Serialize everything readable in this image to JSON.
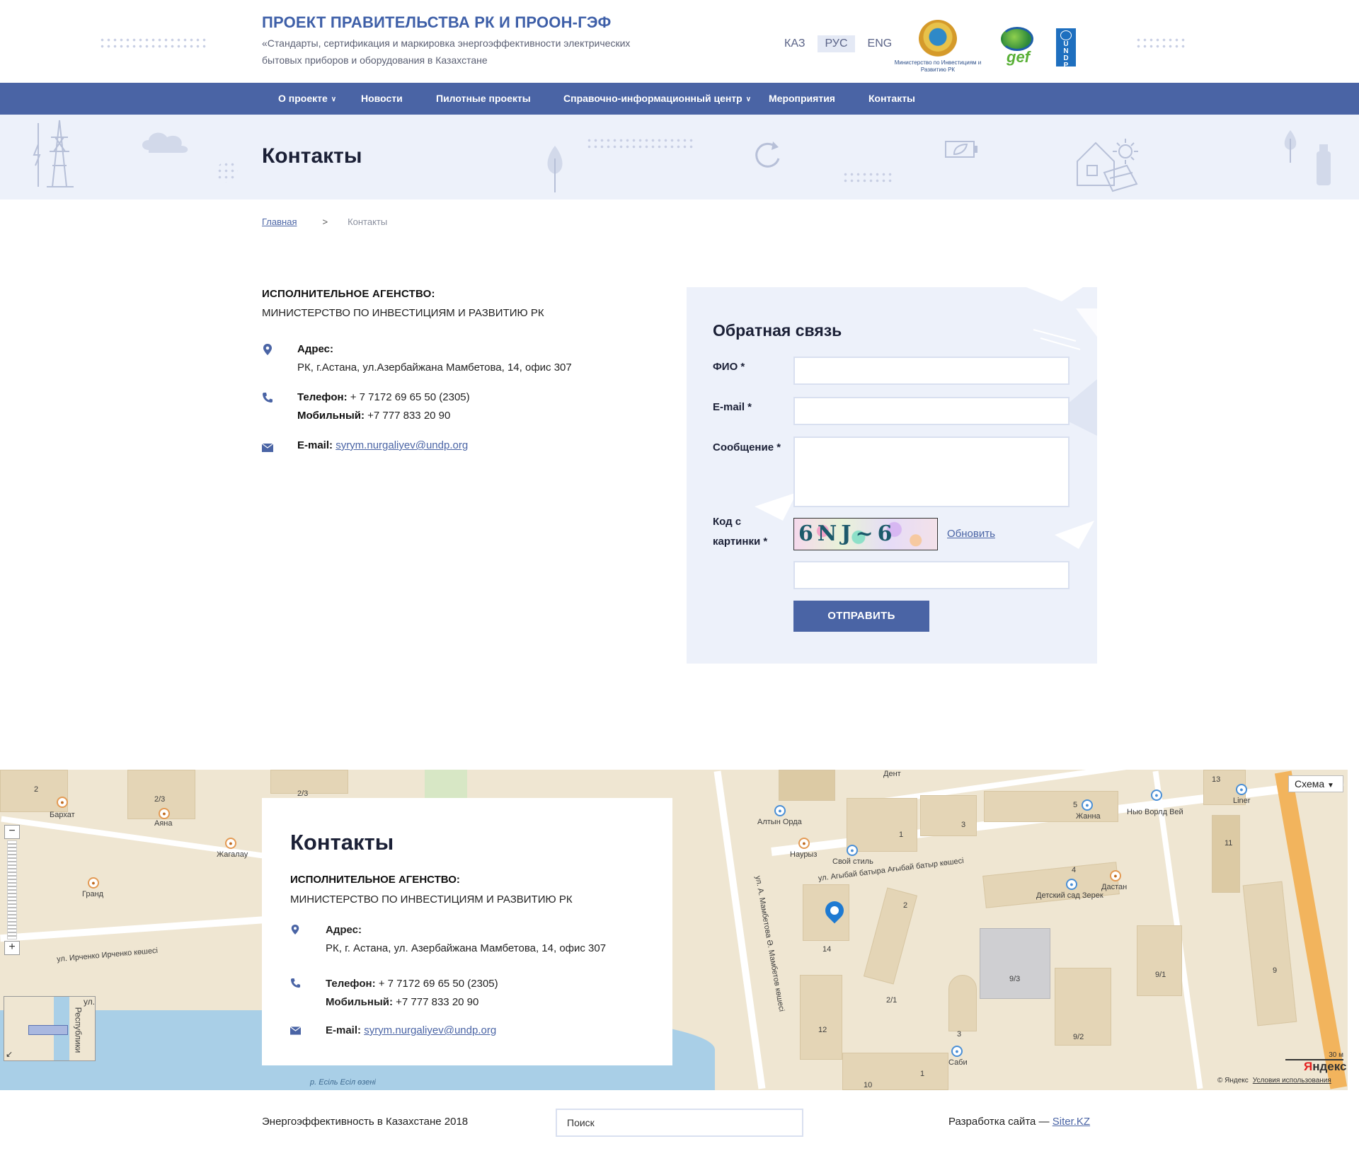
{
  "header": {
    "title": "ПРОЕКТ ПРАВИТЕЛЬСТВА РК И ПРООН-ГЭФ",
    "subtitle": "«Стандарты, сертификация и маркировка энергоэффективности электрических бытовых приборов и оборудования в Казахстане",
    "languages": [
      "КАЗ",
      "РУС",
      "ENG"
    ],
    "active_language": "РУС",
    "ministry_caption": "Министерство по Инвестициям и Развитию РК",
    "gef_label": "gef",
    "undp_label": "U N D P"
  },
  "nav": {
    "items": [
      {
        "label": "О проекте",
        "has_dropdown": true
      },
      {
        "label": "Новости",
        "has_dropdown": false
      },
      {
        "label": "Пилотные проекты",
        "has_dropdown": false
      },
      {
        "label": "Справочно-информационный центр",
        "has_dropdown": true
      },
      {
        "label": "Мероприятия",
        "has_dropdown": false
      },
      {
        "label": "Контакты",
        "has_dropdown": false
      }
    ]
  },
  "banner": {
    "title": "Контакты"
  },
  "breadcrumb": {
    "home": "Главная",
    "separator": ">",
    "current": "Контакты"
  },
  "contacts": {
    "agency_label": "ИСПОЛНИТЕЛЬНОЕ АГЕНСТВО:",
    "agency": "МИНИСТЕРСТВО ПО ИНВЕСТИЦИЯМ И РАЗВИТИЮ РК",
    "address_label": "Адрес:",
    "address": "РК, г.Астана, ул.Азербайжана Мамбетова, 14, офис 307",
    "phone_label": "Телефон:",
    "phone": "+ 7 7172 69 65 50 (2305)",
    "mobile_label": "Мобильный:",
    "mobile": "+7 777 833 20 90",
    "email_label": "E-mail:",
    "email": "syrym.nurgaliyev@undp.org"
  },
  "form": {
    "title": "Обратная связь",
    "name_label": "ФИО *",
    "email_label": "E-mail *",
    "message_label": "Сообщение *",
    "captcha_label_1": "Код с",
    "captcha_label_2": "картинки *",
    "captcha_text": "6NJ~6",
    "refresh_label": "Обновить",
    "submit_label": "ОТПРАВИТЬ"
  },
  "map": {
    "card_title": "Контакты",
    "agency_label": "ИСПОЛНИТЕЛЬНОЕ АГЕНСТВО:",
    "agency": "МИНИСТЕРСТВО ПО ИНВЕСТИЦИЯМ И РАЗВИТИЮ РК",
    "address_label": "Адрес:",
    "address": "РК, г. Астана, ул. Азербайжана Мамбетова, 14, офис 307",
    "phone_label": "Телефон:",
    "phone": "+ 7 7172 69 65 50 (2305)",
    "mobile_label": "Мобильный:",
    "mobile": "+7 777 833 20 90",
    "email_label": "E-mail:",
    "email": "syrym.nurgaliyev@undp.org",
    "scheme_label": "Схема",
    "yandex_label": "Яндекс",
    "copyright": "© Яндекс",
    "terms": "Условия использования",
    "scale": "30 м",
    "labels": {
      "barkhat": "Бархат",
      "ayana": "Аяна",
      "zhagalau": "Жагалау",
      "grand": "Гранд",
      "irchenko": "ул. Ирченко Ирченко көшесі",
      "esil": "р. Есіль Есіл өзені",
      "respubliki": "Республики",
      "altyn_orda": "Алтын Орда",
      "nauryz": "Наурыз",
      "svoy_stil": "Свой стиль",
      "dent": "Дент",
      "zhanna": "Жанна",
      "new_world": "Нью Ворлд Вей",
      "liner": "Liner",
      "agybay": "ул. Агыбай батыра Ағыбай батыр көшесі",
      "mambetova": "ул. А. Мамбетова Ә. Мамбетов көшесі",
      "detsad": "Детский сад Зерек",
      "dastan": "Дастан",
      "sabi": "Саби",
      "n2": "2",
      "n23": "2/3",
      "n232": "2/3",
      "n1": "1",
      "n3": "3",
      "n5": "5",
      "n13": "13",
      "n11": "11",
      "n4": "4",
      "n14": "14",
      "n2b": "2",
      "n21": "2/1",
      "n93": "9/3",
      "n91": "9/1",
      "n9": "9",
      "n92": "9/2",
      "n12": "12",
      "n3b": "3",
      "n10": "10",
      "n1b": "1",
      "ul": "ул."
    }
  },
  "footer": {
    "left": "Энергоэффективность в Казахстане 2018",
    "search_placeholder": "Поиск",
    "right_prefix": "Разработка сайта —",
    "right_link": "Siter.KZ"
  }
}
